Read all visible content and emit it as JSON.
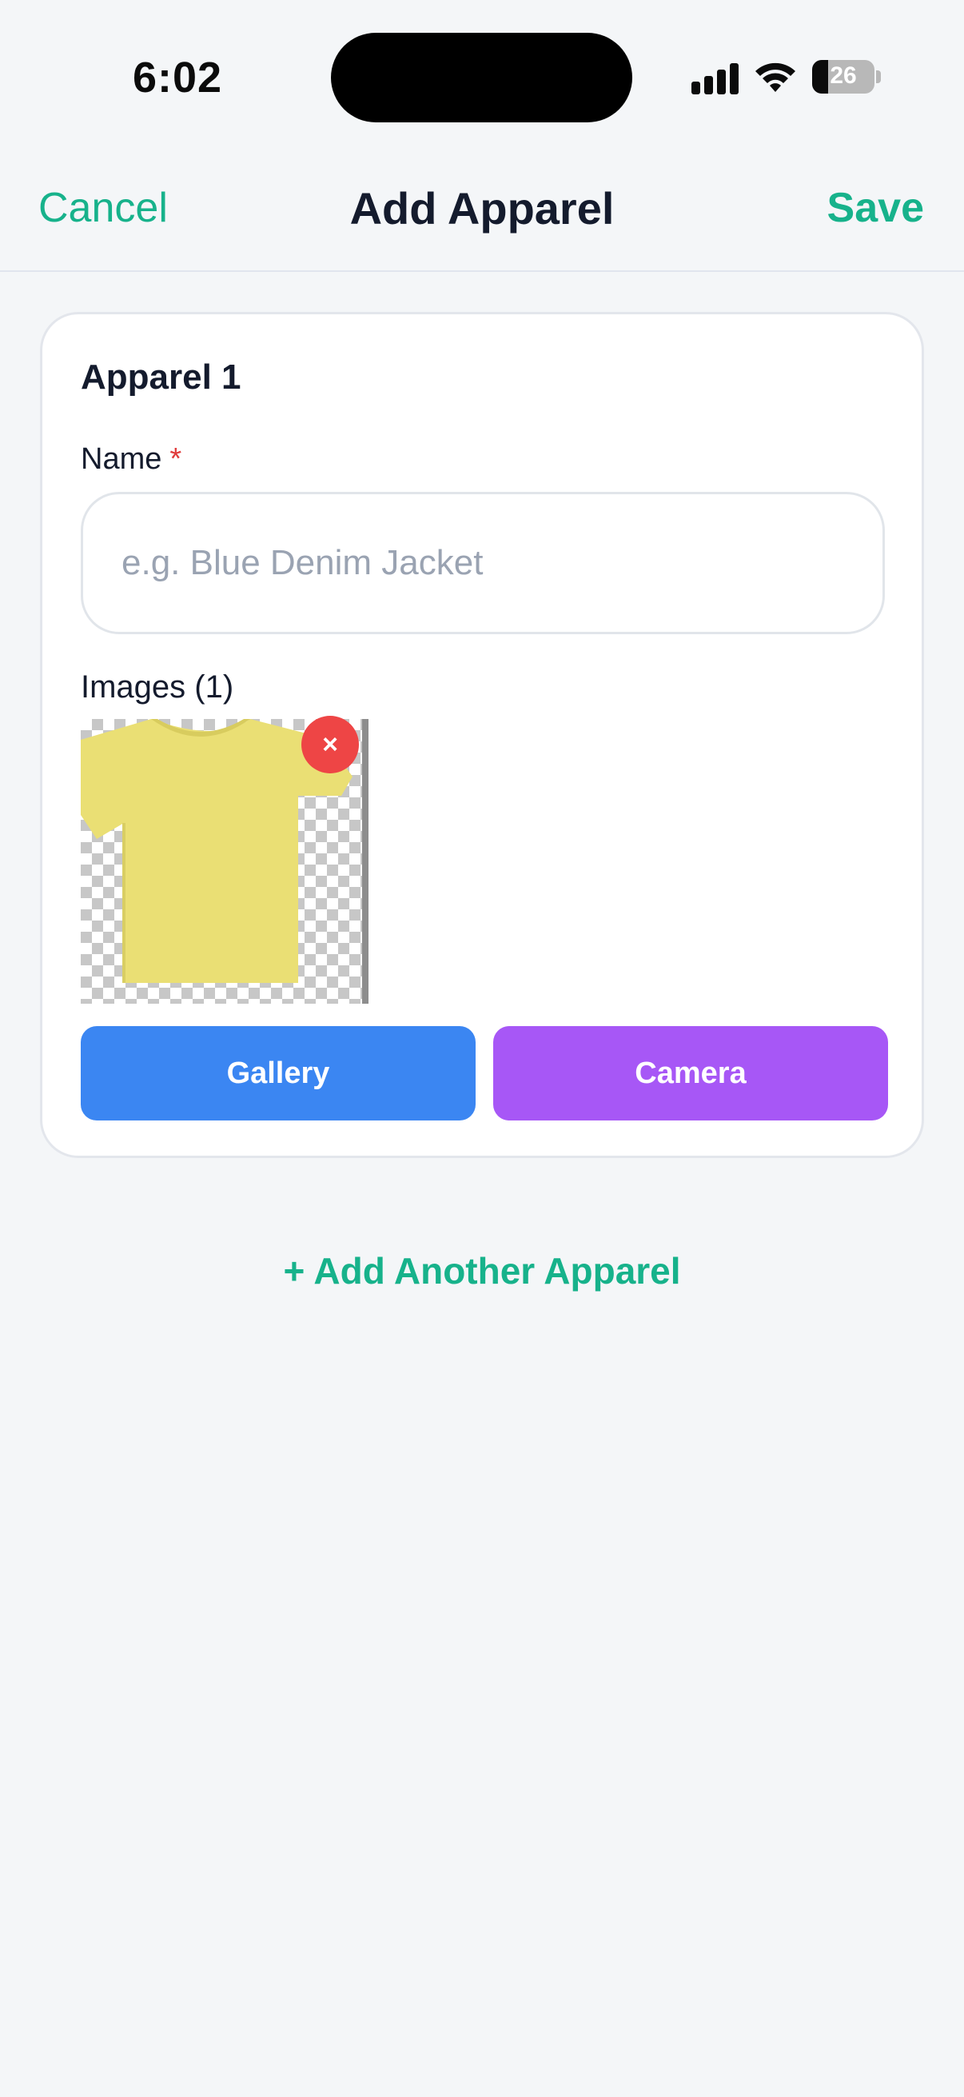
{
  "status_bar": {
    "time": "6:02",
    "battery_level": "26"
  },
  "nav": {
    "cancel_label": "Cancel",
    "title": "Add Apparel",
    "save_label": "Save"
  },
  "apparel_card": {
    "title": "Apparel 1",
    "name_label": "Name",
    "required_mark": "*",
    "name_value": "",
    "name_placeholder": "e.g. Blue Denim Jacket",
    "images_label": "Images (1)",
    "remove_label": "×",
    "gallery_label": "Gallery",
    "camera_label": "Camera"
  },
  "add_another_label": "+ Add Another Apparel",
  "colors": {
    "accent": "#17b28b",
    "gallery": "#3b86f2",
    "camera": "#a757f6",
    "remove": "#ee4545",
    "required": "#e03b3b",
    "tshirt": "#eadf74"
  },
  "icons": [
    "cellular-signal-icon",
    "wifi-icon",
    "battery-icon",
    "close-icon"
  ]
}
